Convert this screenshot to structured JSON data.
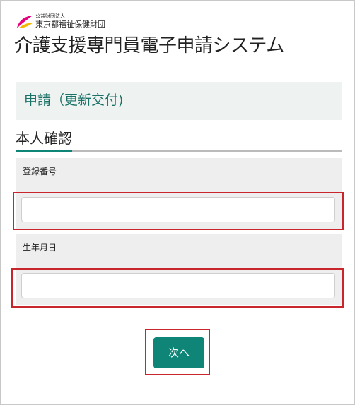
{
  "organization": {
    "prefix": "公益財団法人",
    "name": "東京都福祉保健財団",
    "logo_icon": "leaf-logo"
  },
  "system_title": "介護支援専門員電子申請システム",
  "section_title": "申請（更新交付)",
  "subheading": "本人確認",
  "fields": [
    {
      "label": "登録番号",
      "value": "",
      "placeholder": ""
    },
    {
      "label": "生年月日",
      "value": "",
      "placeholder": ""
    }
  ],
  "next_button_label": "次へ",
  "colors": {
    "accent": "#0f8578",
    "section_text": "#1b7368",
    "highlight": "#c8262c",
    "logo_pink": "#e4007f",
    "logo_yellow": "#f5b800"
  }
}
